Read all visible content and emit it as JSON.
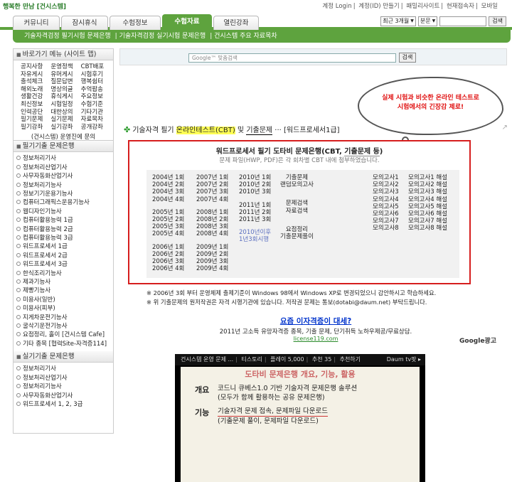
{
  "header": {
    "logo": "행복한 만남 [건시스템]",
    "links": [
      "계정 Login",
      "계정(ID) 만들기",
      "패밀리사이트",
      "현재접속자",
      "모바일"
    ]
  },
  "nav": {
    "tabs": [
      "커뮤니티",
      "잠시휴식",
      "수험정보",
      "수험자료",
      "열린강좌"
    ],
    "active_tab": "수험자료",
    "range_select": "최근 3개월",
    "field_select": "분문",
    "search_button": "검색"
  },
  "subnav": [
    "기술자격검정 필기시험 문제은행",
    "기술자격검정 실기시험 문제은행",
    "건시스템 주요 자료목차"
  ],
  "sidebar": {
    "quick_head": "바로가기 메뉴 (사이트 맵)",
    "sitemap": [
      "공지사항",
      "운영정책",
      "CBT배포",
      "자유게시",
      "유머게시",
      "시험후기",
      "출석체크",
      "질문답변",
      "행복쉼터",
      "해외노래",
      "명상의글",
      "추억팝송",
      "생활건강",
      "휴식게시",
      "주요정보",
      "최신정보",
      "시험일정",
      "수험기준",
      "인력공단",
      "대한상의",
      "기타기관",
      "필기문제",
      "실기문제",
      "자료목차",
      "필기강좌",
      "실기강좌",
      "공개강좌"
    ],
    "note": "(건시스템) 운영진에 문의",
    "written_head": "필기기출 문제은행",
    "written": [
      "정보처리기사",
      "정보처리산업기사",
      "사무자동화산업기사",
      "정보처리기능사",
      "정보기기운용기능사",
      "컴퓨터그래픽스운용기능사",
      "웹디자인기능사",
      "컴퓨터활용능력 1급",
      "컴퓨터활용능력 2급",
      "컴퓨터활용능력 3급",
      "워드프로세서 1급",
      "워드프로세서 2급",
      "워드프로세서 3급",
      "한식조리기능사",
      "제과기능사",
      "제빵기능사",
      "미용사(일반)",
      "미용사(피부)",
      "지게차운전기능사",
      "굴삭기운전기능사",
      "요점정리, 홀이 [건시스템 Cafe]",
      "기타 종목 [협력Site-자격증114]"
    ],
    "practical_head": "실기기출 문제은행",
    "practical": [
      "정보처리기사",
      "정보처리산업기사",
      "정보처리기능사",
      "사무자동화산업기사",
      "워드프로세서 1, 2, 3급"
    ]
  },
  "main": {
    "search_placeholder": "Google™ 맞춤검색",
    "search_button": "검색",
    "bubble_line1": "실제 시험과 비슷한 온라인 테스트로",
    "bubble_line2": "시험에서의 긴장감 제로!",
    "title_pre": "기술자격 필기 ",
    "title_hl": "온라인테스트(CBT)",
    "title_mid": " 및 ",
    "title_hl2": "기출문제",
    "title_post": " ··· [워드프로세서1급]",
    "box_title_pre": "워드프로세서 필기 도타비 문제은행(CBT, ",
    "box_title_ul": "기출문제 등",
    "box_title_post": ")",
    "box_sub": "문제 파일(HWP, PDF)은 각 회차별 CBT 내에 첨부하였습니다.",
    "col1": [
      "2004년 1회",
      "2004년 2회",
      "2004년 3회",
      "2004년 4회",
      "",
      "2005년 1회",
      "2005년 2회",
      "2005년 3회",
      "2005년 4회",
      "",
      "2006년 1회",
      "2006년 2회",
      "2006년 3회",
      "2006년 4회"
    ],
    "col2": [
      "2007년 1회",
      "2007년 2회",
      "2007년 3회",
      "2007년 4회",
      "",
      "2008년 1회",
      "2008년 2회",
      "2008년 3회",
      "2008년 4회",
      "",
      "2009년 1회",
      "2009년 2회",
      "2009년 3회",
      "2009년 4회"
    ],
    "col3": [
      "2010년 1회",
      "2010년 2회",
      "2010년 3회",
      "",
      "2011년 1회",
      "2011년 2회",
      "2011년 3회"
    ],
    "col3_note1": "2010년이후",
    "col3_note2": "1년3회시행",
    "col4": [
      "기출문제",
      "랜덤모의고사",
      "",
      "",
      "문제검색",
      "자료검색",
      "",
      "",
      "요점정리",
      "기출문제풀이"
    ],
    "col5": [
      "모의고사1",
      "모의고사2",
      "모의고사3",
      "모의고사4",
      "모의고사5",
      "모의고사6",
      "모의고사7",
      "모의고사8"
    ],
    "col6": [
      "모의고사1 해설",
      "모의고사2 해설",
      "모의고사3 해설",
      "모의고사4 해설",
      "모의고사5 해설",
      "모의고사6 해설",
      "모의고사7 해설",
      "모의고사8 해설"
    ],
    "note1": "※ 2006년 3회 부터 운영체제 출제기준이 Windows 98에서 Windows XP로 변경되었으니 감안하시고 학습하세요.",
    "note2": "※ 위 기출문제의 원저작권은 자격 시행기관에 있습니다. 저작권 문제는 통보(dotabi@daum.net) 부탁드립니다.",
    "ad_link": "요즘 이자격증이 대세?",
    "ad_desc": "2011년 고소득 유망자격증 종목, 기출 문제, 단기취득 노하우제공/무료상담.",
    "ad_url": "license119.com",
    "ad_label": "Google광고",
    "video_bar": [
      "건시스템 운영 문제 ...",
      "티스토리",
      "플레이 5,000",
      "추천 35",
      "추천하기"
    ],
    "video_brand": "Daum tv팟 ▸",
    "video_title": "도타비 문제은행 개요, 기능, 활용",
    "video_k1": "개요",
    "video_v1a": "코드니 큐베스1.0 기반 기술자격 문제은행 솔루션",
    "video_v1b": "(모두가 함께 활용하는 공유 문제은행)",
    "video_k2": "기능",
    "video_v2a": "기술자격 문제 접속, 문제파일 다운로드",
    "video_v2b": "(기출문제 풀이, 문제파일 다운로드)"
  }
}
